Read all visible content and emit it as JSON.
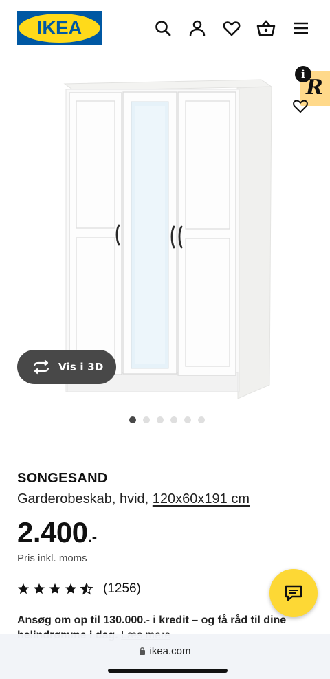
{
  "header": {
    "logo_text": "IKEA",
    "brand_colors": {
      "blue": "#0058a3",
      "yellow": "#ffda1a"
    },
    "icons": [
      "search-icon",
      "account-icon",
      "heart-icon",
      "basket-icon",
      "menu-icon"
    ]
  },
  "gallery": {
    "view_3d_label": "Vis i 3D",
    "slide_count": 6,
    "active_slide": 1,
    "extension_badge": "R",
    "info_glyph": "i"
  },
  "product": {
    "name": "SONGESAND",
    "description": "Garderobeskab, hvid, ",
    "size_link": "120x60x191 cm",
    "price_main": "2.400",
    "price_suffix": ".-",
    "vat_note": "Pris inkl. moms",
    "rating_value": 4.5,
    "rating_max": 5,
    "review_count": "(1256)",
    "credit_text": "Ansøg om op til 130.000.- i kredit – og få råd til dine",
    "credit_text_2": "helindrømme i dag.",
    "credit_more": "Læs mere"
  },
  "browser": {
    "url": "ikea.com"
  },
  "colors": {
    "accent_yellow": "#fdd835",
    "dark_button": "#484848"
  }
}
